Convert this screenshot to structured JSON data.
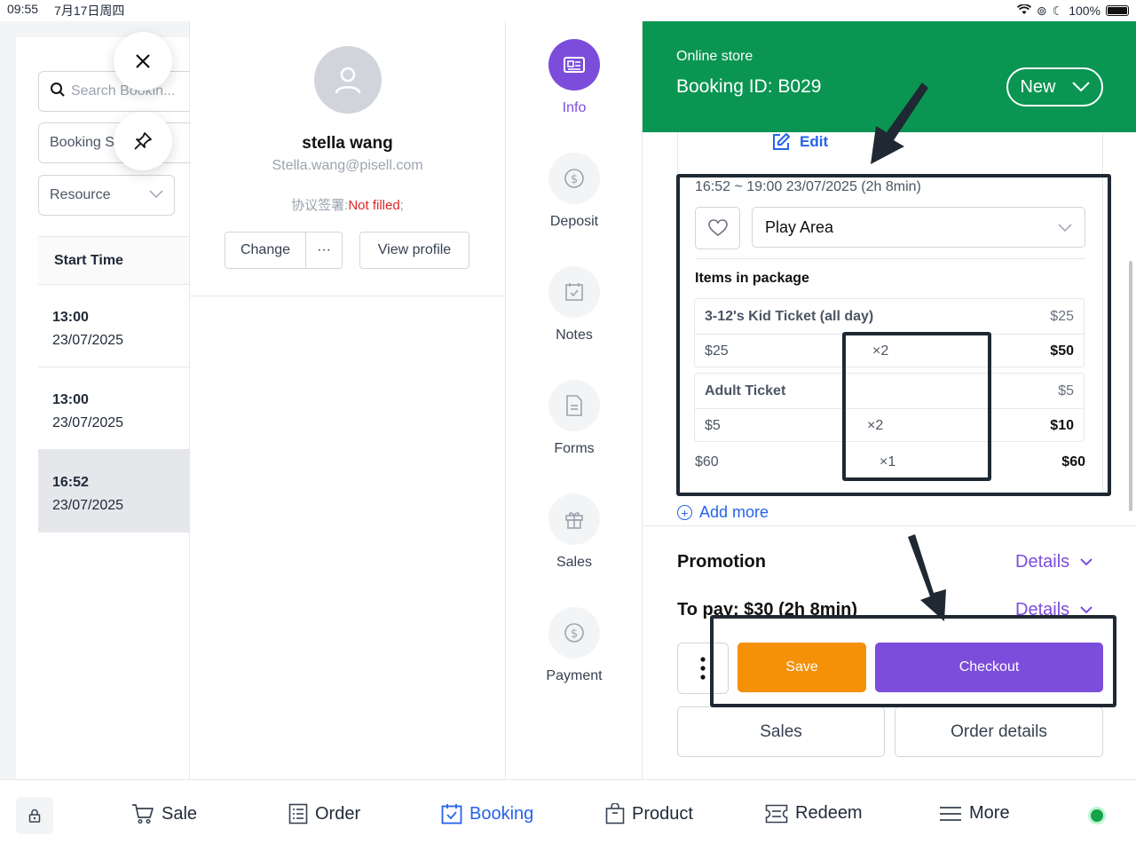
{
  "status_bar": {
    "time": "09:55",
    "date": "7月17日周四",
    "battery": "100%"
  },
  "left_panel": {
    "search_placeholder": "Search Bookin...",
    "booking_filter": "Booking S",
    "resource_filter": "Resource",
    "column_header": "Start Time",
    "rows": [
      {
        "time": "13:00",
        "date": "23/07/2025"
      },
      {
        "time": "13:00",
        "date": "23/07/2025"
      },
      {
        "time": "16:52",
        "date": "23/07/2025"
      }
    ]
  },
  "customer": {
    "name": "stella wang",
    "email": "Stella.wang@pisell.com",
    "agreement_label": "协议签署:",
    "agreement_status": "Not filled",
    "agreement_suffix": ";",
    "change_label": "Change",
    "more_label": "···",
    "view_profile_label": "View profile"
  },
  "nav": {
    "items": [
      {
        "label": "Info",
        "icon": "id-card-icon"
      },
      {
        "label": "Deposit",
        "icon": "dollar-icon"
      },
      {
        "label": "Notes",
        "icon": "calendar-check-icon"
      },
      {
        "label": "Forms",
        "icon": "document-icon"
      },
      {
        "label": "Sales",
        "icon": "gift-icon"
      },
      {
        "label": "Payment",
        "icon": "dollar-icon"
      }
    ],
    "active": "Info"
  },
  "booking": {
    "store": "Online store",
    "booking_id": "Booking ID: B029",
    "status_button": "New",
    "edit_label": "Edit",
    "time_range": "16:52 ~ 19:00 23/07/2025 (2h 8min)",
    "area": "Play Area",
    "items_title": "Items in package",
    "items": [
      {
        "name": "3-12's Kid Ticket (all day)",
        "unit_price": "$25",
        "price": "$25",
        "qty": "×2",
        "total": "$50"
      },
      {
        "name": "Adult Ticket",
        "unit_price": "$5",
        "price": "$5",
        "qty": "×2",
        "total": "$10"
      }
    ],
    "summary": {
      "price": "$60",
      "qty": "×1",
      "total": "$60"
    },
    "add_more": "Add more",
    "promotion_label": "Promotion",
    "details_label": "Details",
    "to_pay": "To pay: $30 (2h 8min)",
    "save_label": "Save",
    "checkout_label": "Checkout",
    "sales_label": "Sales",
    "order_details_label": "Order details"
  },
  "bottom_nav": {
    "items": [
      {
        "label": "Sale",
        "icon": "cart-icon"
      },
      {
        "label": "Order",
        "icon": "list-icon"
      },
      {
        "label": "Booking",
        "icon": "calendar-check-icon"
      },
      {
        "label": "Product",
        "icon": "bag-icon"
      },
      {
        "label": "Redeem",
        "icon": "ticket-icon"
      },
      {
        "label": "More",
        "icon": "menu-icon"
      }
    ],
    "active": "Booking"
  },
  "colors": {
    "header_green": "#0a9553",
    "accent_purple": "#7c4ddb",
    "save_orange": "#f59009",
    "link_blue": "#2563eb",
    "warning_red": "#dc2626"
  }
}
